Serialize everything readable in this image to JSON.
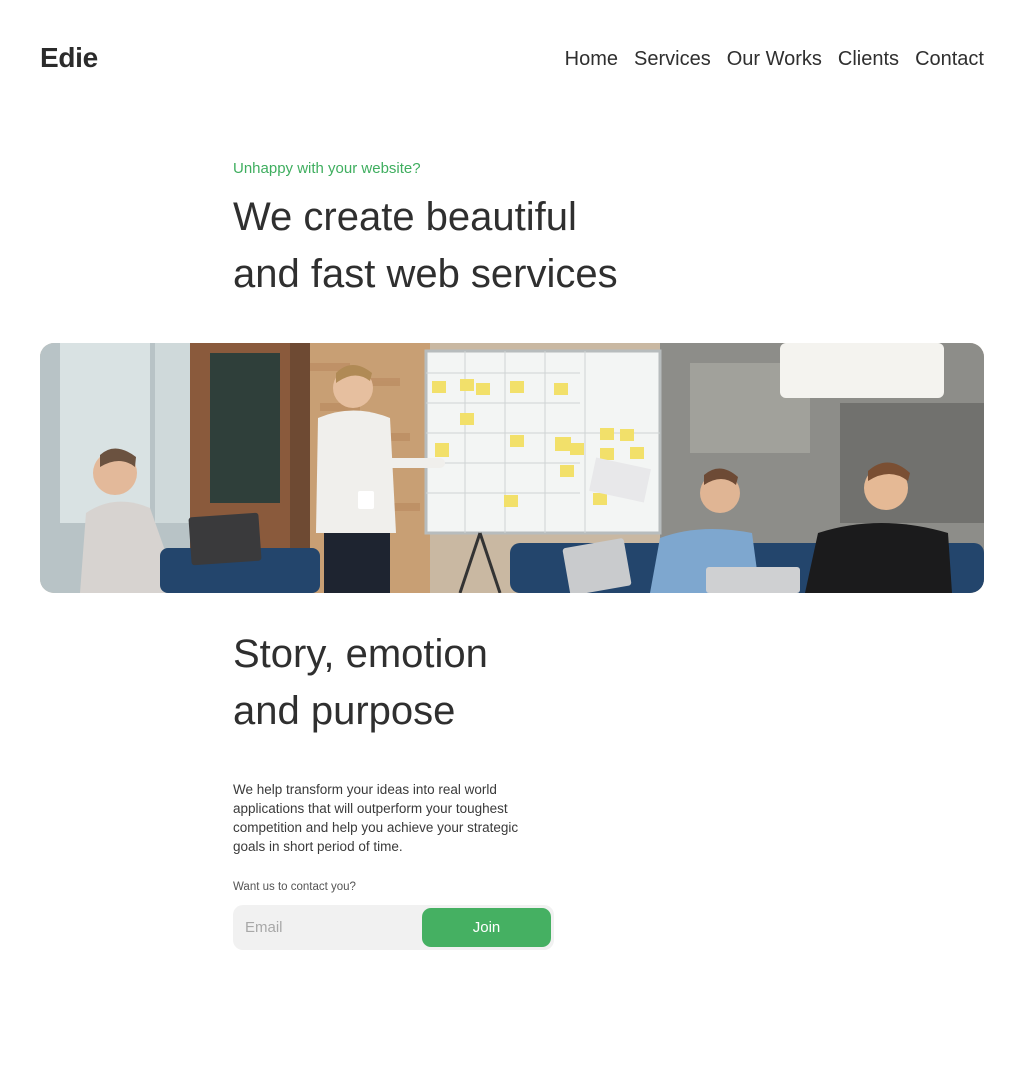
{
  "brand": {
    "logo": "Edie",
    "accent": "#45b062"
  },
  "nav": {
    "items": [
      {
        "label": "Home"
      },
      {
        "label": "Services"
      },
      {
        "label": "Our Works"
      },
      {
        "label": "Clients"
      },
      {
        "label": "Contact"
      }
    ]
  },
  "hero": {
    "eyebrow": "Unhappy with your website?",
    "title_line1": "We create beautiful",
    "title_line2": "and fast web services"
  },
  "story": {
    "title_line1": "Story, emotion",
    "title_line2": "and purpose",
    "body": "We help transform your ideas into real world applications that will outperform your toughest competition and help you achieve your strategic goals in short period of time."
  },
  "signup": {
    "label": "Want us to contact you?",
    "email_placeholder": "Email",
    "join_label": "Join"
  }
}
